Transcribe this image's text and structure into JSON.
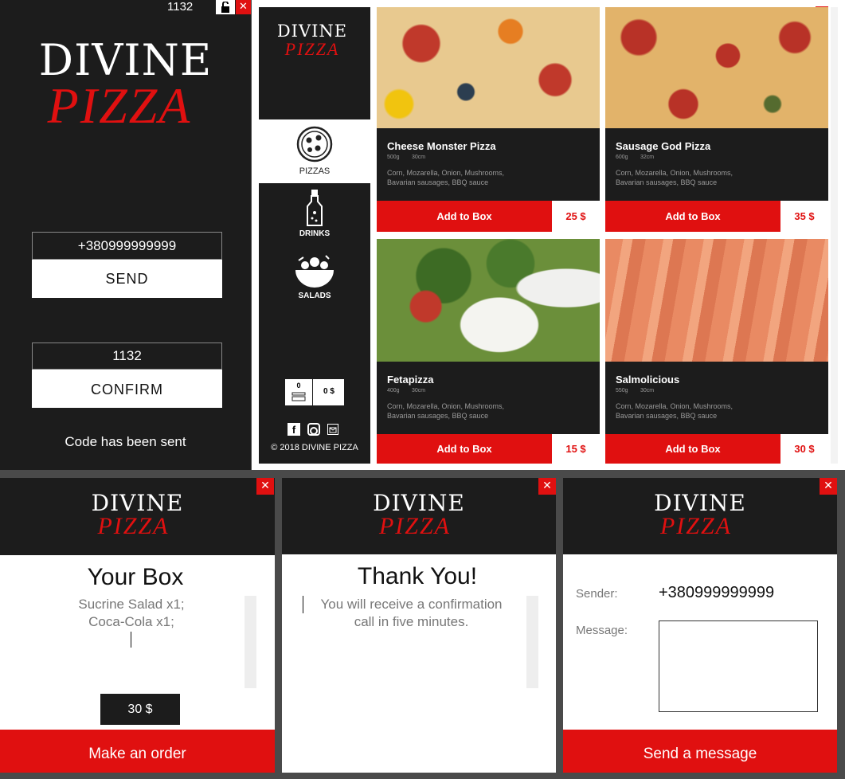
{
  "colors": {
    "accent": "#e01010",
    "dark": "#1c1c1c",
    "background": "#4a4a4a"
  },
  "login": {
    "code_display": "1132",
    "logo_top": "DIVINE",
    "logo_bottom": "PIZZA",
    "phone_value": "+380999999999",
    "send_label": "SEND",
    "code_value": "1132",
    "confirm_label": "CONFIRM",
    "status": "Code has been sent",
    "close_symbol": "✕",
    "lock_icon": "unlock-icon"
  },
  "menu": {
    "logo_top": "DIVINE",
    "logo_bottom": "PIZZA",
    "nav": [
      {
        "label": "PIZZAS",
        "icon": "pizza-icon",
        "active": true
      },
      {
        "label": "DRINKS",
        "icon": "bottle-icon",
        "active": false
      },
      {
        "label": "SALADS",
        "icon": "salad-bowl-icon",
        "active": false
      }
    ],
    "box_count": "0",
    "box_total": "0 $",
    "copyright": "© 2018 DIVINE PIZZA",
    "close_symbol": "✕",
    "products": [
      {
        "name": "Cheese Monster Pizza",
        "weight": "500g",
        "size": "30cm",
        "desc_line1": "Corn, Mozarella, Onion, Mushrooms,",
        "desc_line2": "Bavarian sausages, BBQ sauce",
        "add_label": "Add to Box",
        "price": "25 $"
      },
      {
        "name": "Sausage God Pizza",
        "weight": "600g",
        "size": "32cm",
        "desc_line1": "Corn, Mozarella, Onion, Mushrooms,",
        "desc_line2": "Bavarian sausages, BBQ sauce",
        "add_label": "Add to Box",
        "price": "35 $"
      },
      {
        "name": "Fetapizza",
        "weight": "400g",
        "size": "30cm",
        "desc_line1": "Corn, Mozarella, Onion, Mushrooms,",
        "desc_line2": "Bavarian sausages, BBQ sauce",
        "add_label": "Add to Box",
        "price": "15 $"
      },
      {
        "name": "Salmolicious",
        "weight": "550g",
        "size": "30cm",
        "desc_line1": "Corn, Mozarella, Onion, Mushrooms,",
        "desc_line2": "Bavarian sausages, BBQ sauce",
        "add_label": "Add to Box",
        "price": "30 $"
      }
    ]
  },
  "box": {
    "logo_top": "DIVINE",
    "logo_bottom": "PIZZA",
    "title": "Your Box",
    "item1": "Sucrine Salad x1;",
    "item2": "Coca-Cola x1;",
    "total": "30 $",
    "order_label": "Make an order",
    "close_symbol": "✕"
  },
  "thanks": {
    "logo_top": "DIVINE",
    "logo_bottom": "PIZZA",
    "title": "Thank You!",
    "line1": "You will receive a confirmation",
    "line2": "call in five minutes.",
    "close_symbol": "✕"
  },
  "message": {
    "logo_top": "DIVINE",
    "logo_bottom": "PIZZA",
    "sender_label": "Sender:",
    "sender_value": "+380999999999",
    "message_label": "Message:",
    "send_label": "Send a message",
    "close_symbol": "✕"
  }
}
